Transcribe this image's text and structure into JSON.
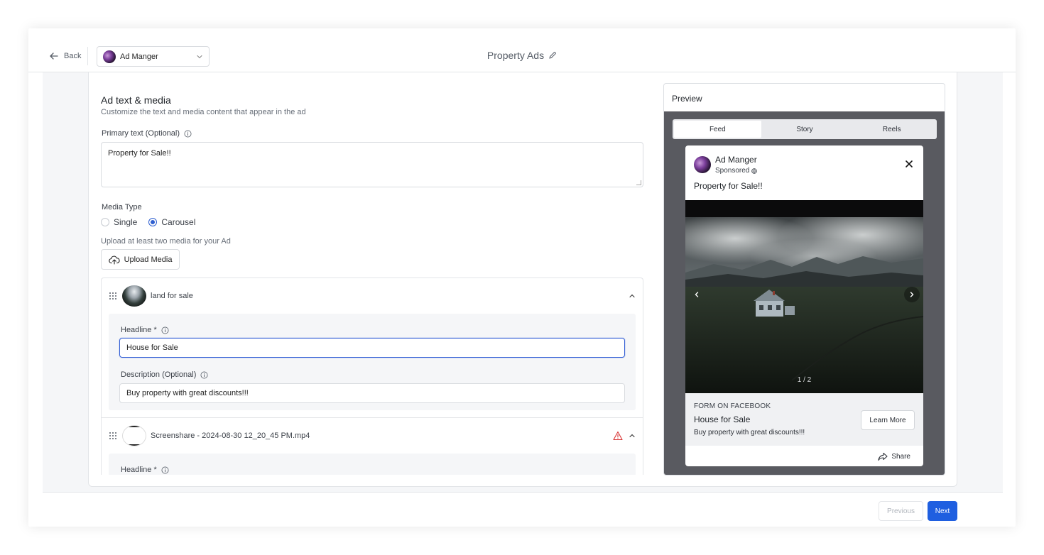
{
  "header": {
    "back_label": "Back",
    "account_name": "Ad Manger",
    "page_title": "Property Ads"
  },
  "section": {
    "title": "Ad text & media",
    "subtitle": "Customize the text and media content that appear in the ad"
  },
  "primary_text": {
    "label": "Primary text (Optional)",
    "value": "Property for Sale!!"
  },
  "media_type": {
    "label": "Media Type",
    "options": [
      "Single",
      "Carousel"
    ],
    "selected": "Carousel"
  },
  "upload": {
    "hint": "Upload at least two media for your Ad",
    "button_label": "Upload Media"
  },
  "media_items": [
    {
      "name": "land for sale",
      "headline_label": "Headline *",
      "headline_value": "House for Sale",
      "description_label": "Description (Optional)",
      "description_value": "Buy property with great discounts!!!"
    },
    {
      "name": "Screenshare - 2024-08-30 12_20_45 PM.mp4",
      "headline_label": "Headline *",
      "has_warning": true
    }
  ],
  "preview": {
    "title": "Preview",
    "tabs": [
      "Feed",
      "Story",
      "Reels"
    ],
    "active_tab": "Feed",
    "post": {
      "account_name": "Ad Manger",
      "sponsored_label": "Sponsored",
      "text": "Property for Sale!!",
      "carousel_counter": "1 / 2",
      "cta_source": "FORM ON FACEBOOK",
      "headline": "House for Sale",
      "description": "Buy property with great discounts!!!",
      "cta_button": "Learn More",
      "share_label": "Share"
    }
  },
  "footer": {
    "previous_label": "Previous",
    "next_label": "Next"
  },
  "colors": {
    "primary": "#1f5fe0",
    "radio_selected": "#2f5fd0",
    "warning": "#d93636"
  }
}
